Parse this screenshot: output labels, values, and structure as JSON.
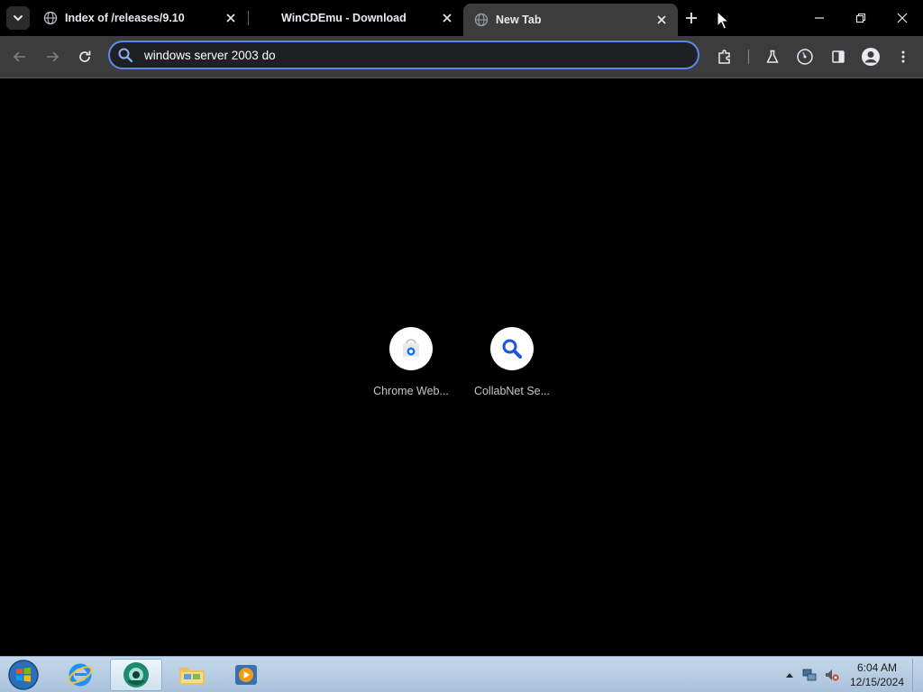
{
  "browser": {
    "tabs": [
      {
        "title": "Index of /releases/9.10",
        "active": false,
        "favicon": "globe-icon"
      },
      {
        "title": "WinCDEmu - Download",
        "active": false,
        "favicon": "none"
      },
      {
        "title": "New Tab",
        "active": true,
        "favicon": "globe-icon"
      }
    ],
    "omnibox": {
      "value": "windows server 2003 do",
      "icon": "search-icon"
    }
  },
  "shortcuts": [
    {
      "label": "Chrome Web...",
      "icon": "chrome-web-store-icon"
    },
    {
      "label": "CollabNet Se...",
      "icon": "magnifier-icon"
    }
  ],
  "taskbar": {
    "apps": [
      {
        "name": "internet-explorer",
        "icon": "ie-icon"
      },
      {
        "name": "chrome",
        "icon": "browser-icon",
        "active": true
      },
      {
        "name": "file-explorer",
        "icon": "folder-icon"
      },
      {
        "name": "media-player",
        "icon": "media-player-icon"
      }
    ],
    "clock": {
      "time": "6:04 AM",
      "date": "12/15/2024"
    }
  },
  "colors": {
    "background": "#000000",
    "toolbar": "#3c3c3c",
    "omnibox_border": "#5a8ae6",
    "accent_blue": "#1a56db"
  }
}
